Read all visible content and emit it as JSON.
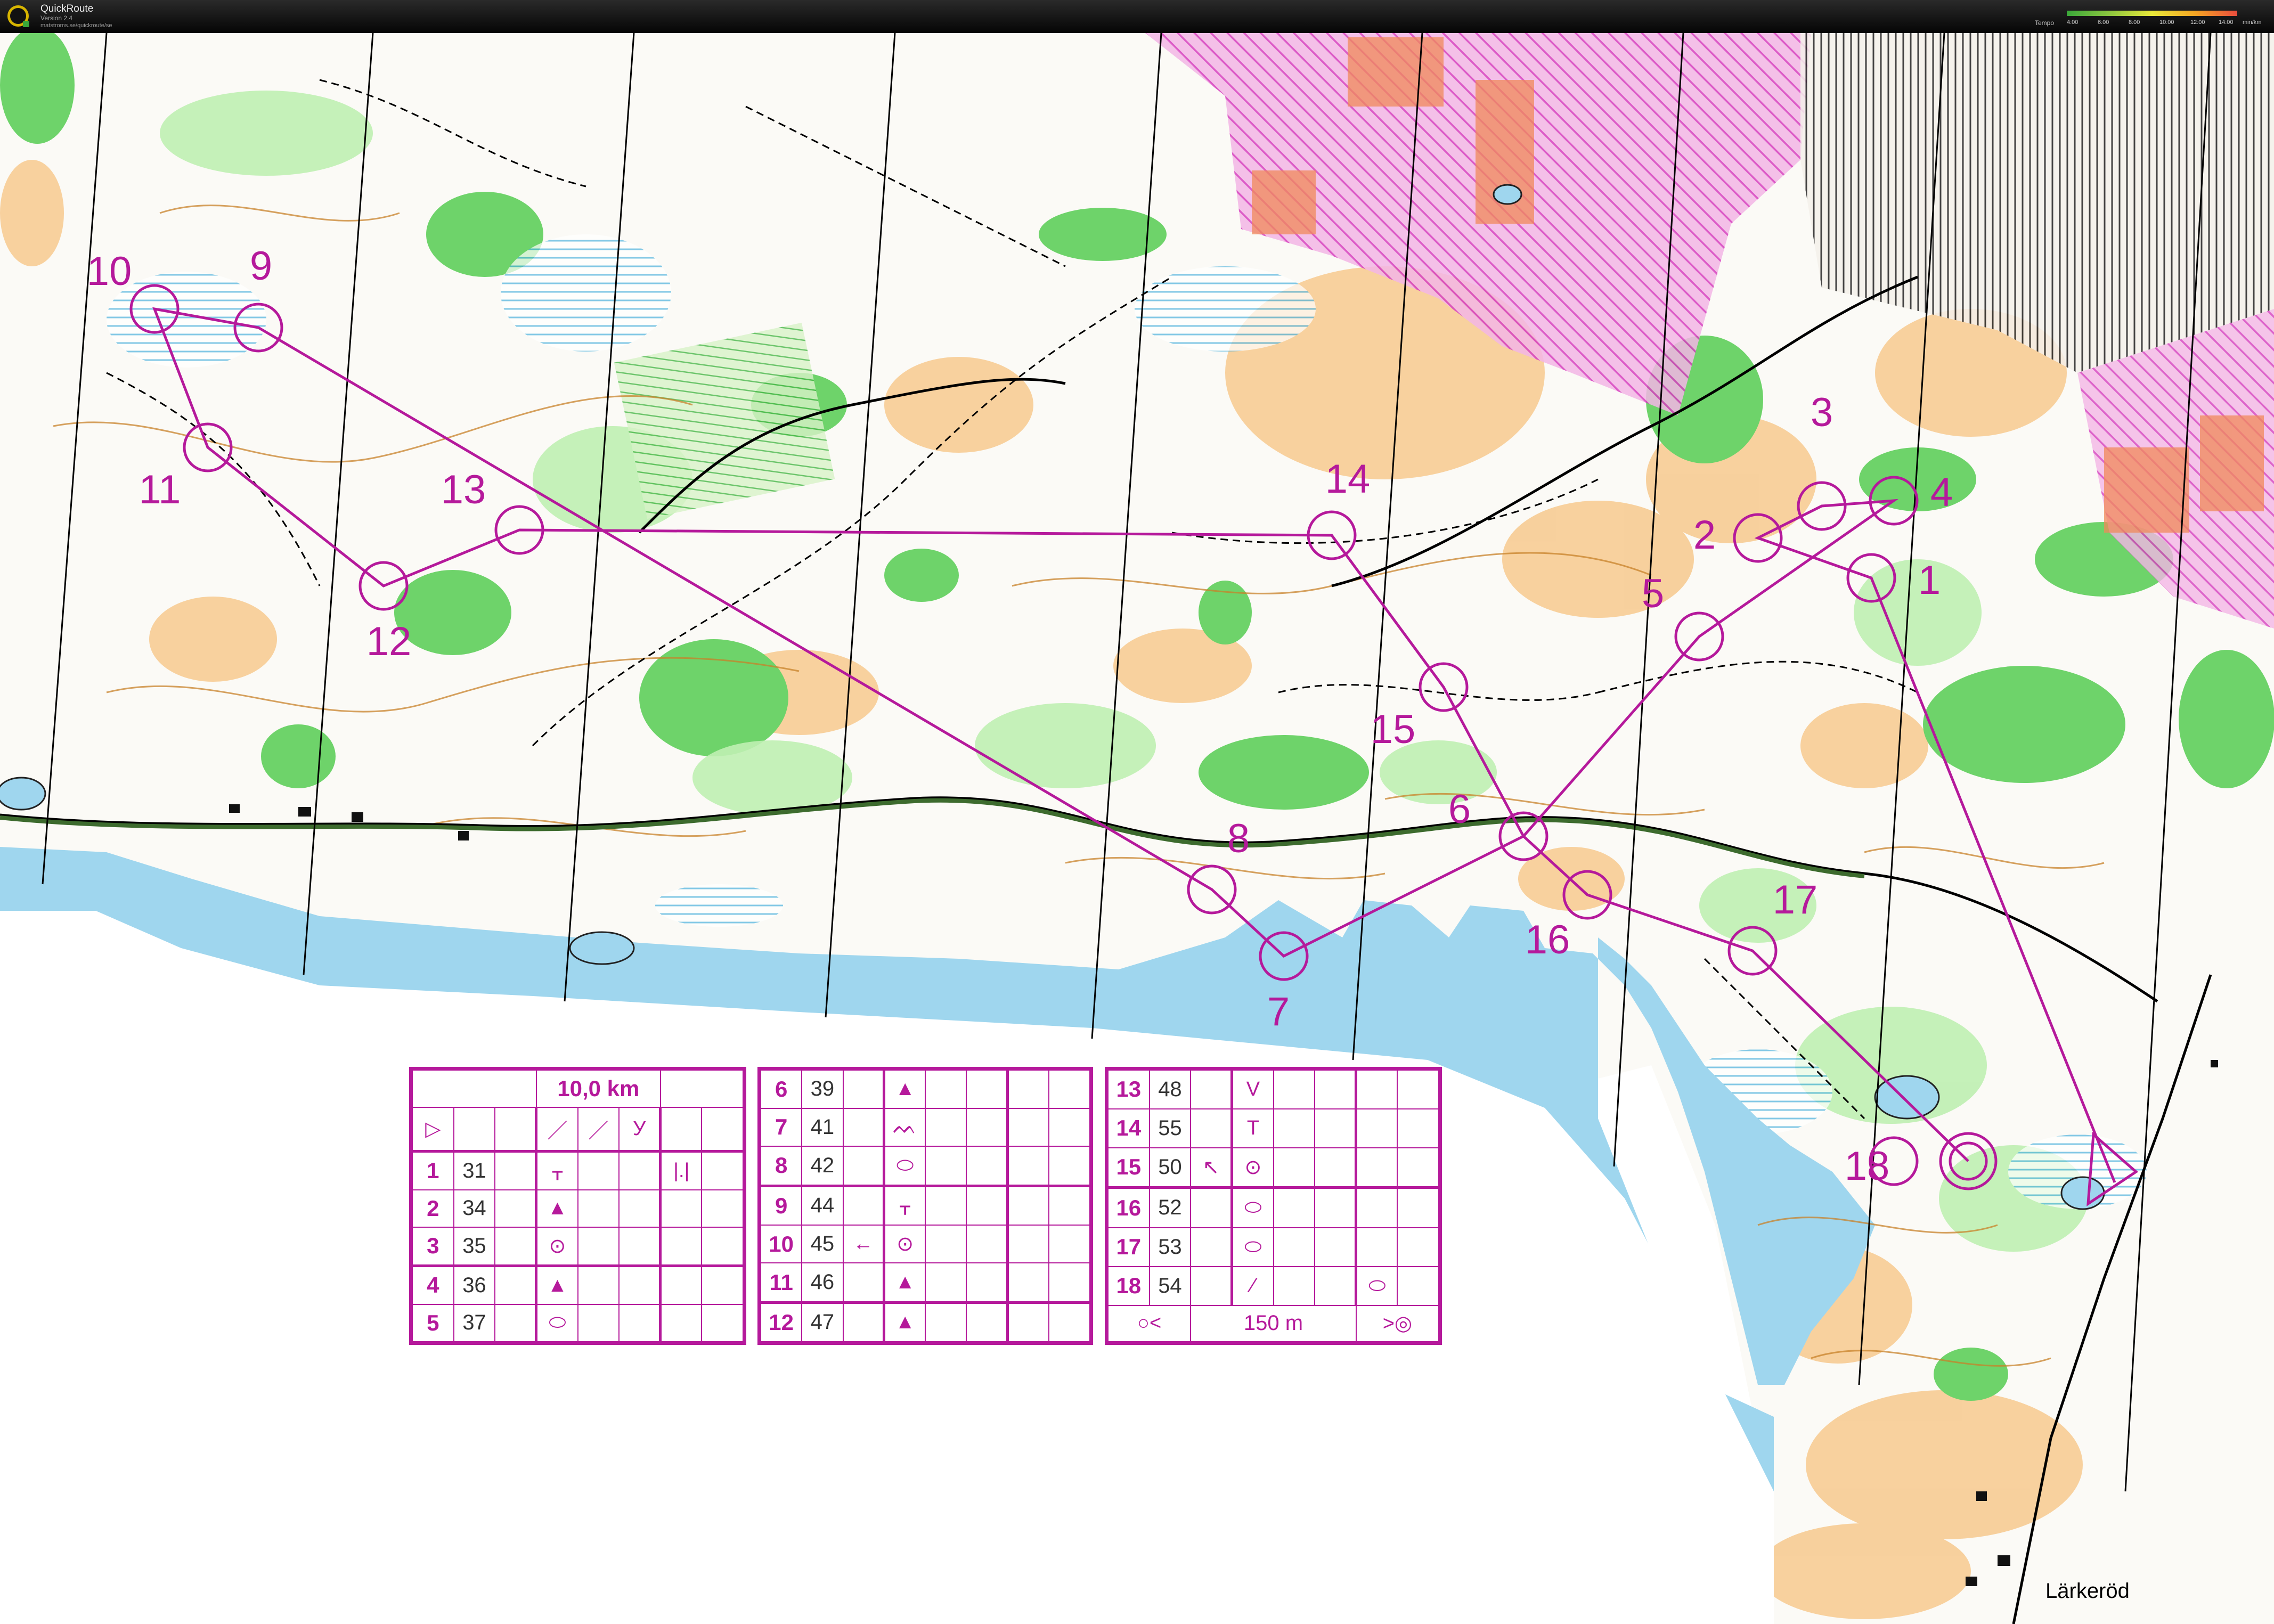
{
  "window": {
    "title": "QuickRoute",
    "version": "Version 2.4",
    "url": "matstroms.se/quickroute/se"
  },
  "speed_legend": {
    "label": "Tempo",
    "ticks": [
      "4:00",
      "6:00",
      "8:00",
      "10:00",
      "12:00",
      "14:00"
    ],
    "unit": "min/km",
    "colors": [
      "#3aa83a",
      "#8cc63f",
      "#e8e83a",
      "#f5a623",
      "#e84c3d"
    ]
  },
  "map": {
    "place_label": "Lärkeröd",
    "course_color": "#b5199b",
    "water_color": "#9fd6ee",
    "controls": [
      {
        "label": "1"
      },
      {
        "label": "2"
      },
      {
        "label": "3"
      },
      {
        "label": "4"
      },
      {
        "label": "5"
      },
      {
        "label": "6"
      },
      {
        "label": "7"
      },
      {
        "label": "8"
      },
      {
        "label": "9"
      },
      {
        "label": "10"
      },
      {
        "label": "11"
      },
      {
        "label": "12"
      },
      {
        "label": "13"
      },
      {
        "label": "14"
      },
      {
        "label": "15"
      },
      {
        "label": "16"
      },
      {
        "label": "17"
      },
      {
        "label": "18"
      }
    ]
  },
  "description_sheet": {
    "course_length": "10,0 km",
    "start_symbol": "▷",
    "start_features": [
      "／",
      "／",
      "У"
    ],
    "controls": [
      {
        "num": "1",
        "code": "31",
        "dir": "",
        "feature": "ᚁ",
        "extra": "|.|"
      },
      {
        "num": "2",
        "code": "34",
        "dir": "",
        "feature": "▲",
        "extra": ""
      },
      {
        "num": "3",
        "code": "35",
        "dir": "",
        "feature": "⊙",
        "extra": ""
      },
      {
        "num": "4",
        "code": "36",
        "dir": "",
        "feature": "▲",
        "extra": ""
      },
      {
        "num": "5",
        "code": "37",
        "dir": "",
        "feature": "⬭",
        "extra": ""
      },
      {
        "num": "6",
        "code": "39",
        "dir": "",
        "feature": "▲",
        "extra": ""
      },
      {
        "num": "7",
        "code": "41",
        "dir": "",
        "feature": "ᨓ",
        "extra": ""
      },
      {
        "num": "8",
        "code": "42",
        "dir": "",
        "feature": "⬭",
        "extra": ""
      },
      {
        "num": "9",
        "code": "44",
        "dir": "",
        "feature": "ᚁ",
        "extra": ""
      },
      {
        "num": "10",
        "code": "45",
        "dir": "←",
        "feature": "⊙",
        "extra": ""
      },
      {
        "num": "11",
        "code": "46",
        "dir": "",
        "feature": "▲",
        "extra": ""
      },
      {
        "num": "12",
        "code": "47",
        "dir": "",
        "feature": "▲",
        "extra": ""
      },
      {
        "num": "13",
        "code": "48",
        "dir": "",
        "feature": "V",
        "extra": ""
      },
      {
        "num": "14",
        "code": "55",
        "dir": "",
        "feature": "T",
        "extra": ""
      },
      {
        "num": "15",
        "code": "50",
        "dir": "↖",
        "feature": "⊙",
        "extra": ""
      },
      {
        "num": "16",
        "code": "52",
        "dir": "",
        "feature": "⬭",
        "extra": ""
      },
      {
        "num": "17",
        "code": "53",
        "dir": "",
        "feature": "⬭",
        "extra": ""
      },
      {
        "num": "18",
        "code": "54",
        "dir": "",
        "feature": "⁄",
        "extra": "⬭"
      }
    ],
    "finish_left": "○<",
    "finish_distance": "150 m",
    "finish_right": ">◎"
  }
}
